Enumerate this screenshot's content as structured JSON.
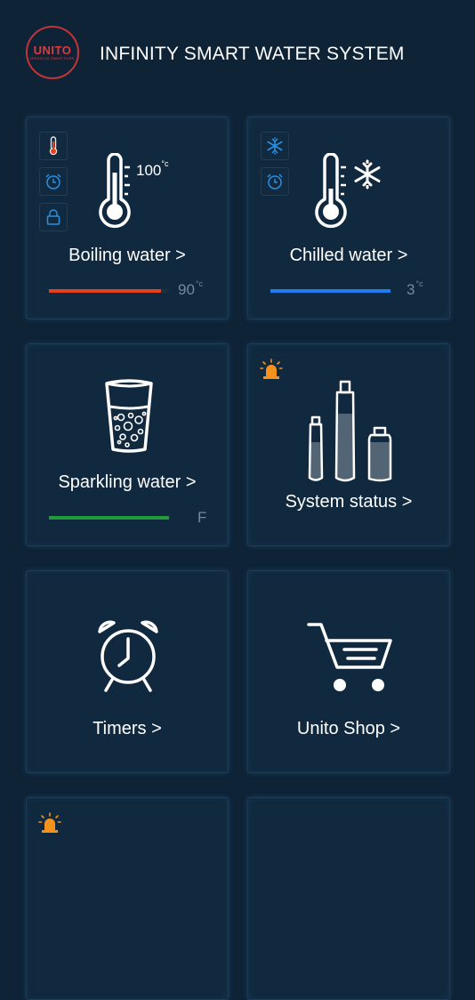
{
  "header": {
    "logo_text": "UNITO",
    "logo_tagline": "VERSATILE.SMART.PURE.",
    "title": "INFINITY SMART WATER SYSTEM"
  },
  "tiles": [
    {
      "label": "Boiling water  >",
      "side_icons": [
        "thermometer-icon",
        "alarm-clock-icon",
        "padlock-icon"
      ],
      "main_icon": "thermometer-icon",
      "setpoint": "100",
      "setpoint_unit": "°c",
      "level": 0.93,
      "bar_color": "#e8401a",
      "reading": "90",
      "reading_unit": "°c"
    },
    {
      "label": "Chilled water  >",
      "side_icons": [
        "snowflake-icon",
        "alarm-clock-icon"
      ],
      "main_icon": "thermometer-snowflake-icon",
      "level": 1.0,
      "bar_color": "#1e7ef0",
      "reading": "3",
      "reading_unit": "°c"
    },
    {
      "label": "Sparkling water  >",
      "main_icon": "glass-with-bubbles-icon",
      "level": 1.0,
      "bar_color": "#1f9b3a",
      "indicator": "F"
    },
    {
      "label": "System status  >",
      "alert_icon": "alarm-light-icon",
      "main_icon": "bottles-icon"
    },
    {
      "label": "Timers  >",
      "main_icon": "alarm-clock-icon"
    },
    {
      "label": "Unito Shop  >",
      "main_icon": "shopping-cart-icon"
    },
    {
      "alert_icon": "alarm-light-icon"
    },
    {}
  ],
  "colors": {
    "background": "#0f2336",
    "tile": "#11293f",
    "icon_blue": "#2b8fe0",
    "alert_orange": "#f5921e",
    "logo_red": "#e03a3e"
  }
}
